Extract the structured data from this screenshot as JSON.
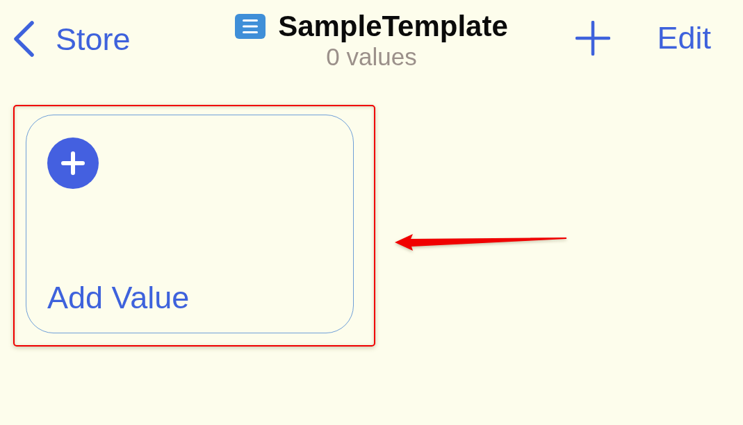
{
  "nav_bar": {
    "back_button": {
      "label": "Store"
    },
    "title": "SampleTemplate",
    "subtitle": "0 values",
    "edit_button": {
      "label": "Edit"
    }
  },
  "cards": [
    {
      "kind": "add",
      "label": "Add Value",
      "highlighted": true
    }
  ]
}
